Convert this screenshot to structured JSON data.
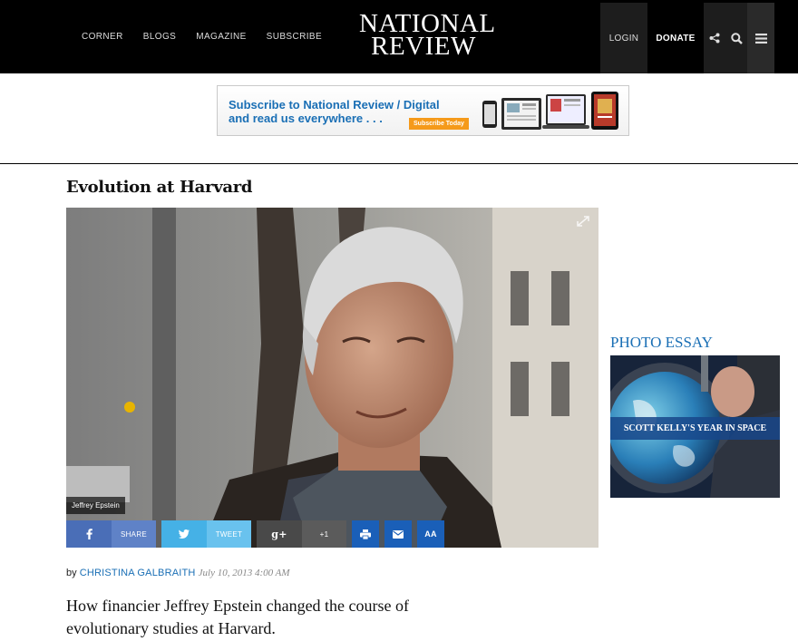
{
  "nav": {
    "links": [
      "CORNER",
      "BLOGS",
      "MAGAZINE",
      "SUBSCRIBE"
    ],
    "logo_line1": "NATIONAL",
    "logo_line2": "REVIEW",
    "login": "LOGIN",
    "donate": "DONATE"
  },
  "ad": {
    "line1": "Subscribe to National Review / Digital",
    "line2": "and read us everywhere . . .",
    "button": "Subscribe Today"
  },
  "article": {
    "title": "Evolution at Harvard",
    "caption": "Jeffrey Epstein",
    "byline_prefix": "by",
    "author": "CHRISTINA GALBRAITH",
    "date": "July 10, 2013 4:00 AM",
    "dek": "How financier Jeffrey Epstein changed the course of evolutionary studies at Harvard."
  },
  "share": {
    "facebook_label": "SHARE",
    "twitter_label": "TWEET",
    "gplus_count": "+1",
    "text_size": "AA"
  },
  "sidebar": {
    "section_label": "PHOTO ESSAY",
    "essay_title": "SCOTT KELLY'S YEAR IN SPACE"
  },
  "colors": {
    "accent": "#1a6fb5",
    "facebook": "#4a6eb7",
    "twitter": "#45b1e6",
    "gplus": "#494949",
    "ad_button": "#f59a1a"
  }
}
